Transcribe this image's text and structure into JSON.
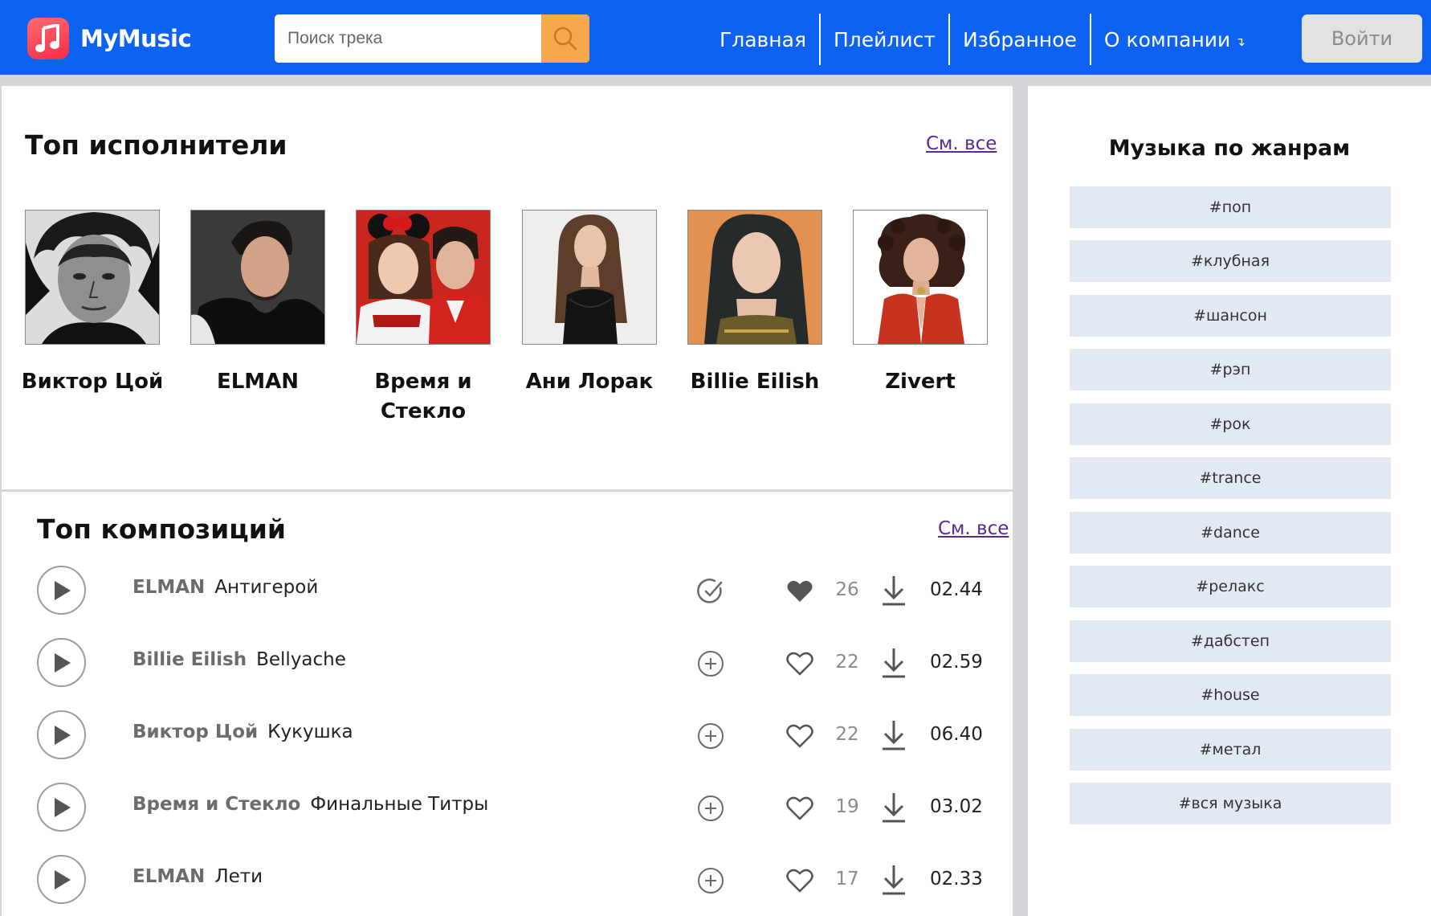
{
  "header": {
    "brand": "MyMusic",
    "search_placeholder": "Поиск трека",
    "nav": [
      "Главная",
      "Плейлист",
      "Избранное",
      "О компании"
    ],
    "nav_dropdown_arrow": "↴",
    "login_label": "Войти"
  },
  "top_artists": {
    "title": "Топ исполнители",
    "see_all": "См. все",
    "items": [
      {
        "name": "Виктор Цой",
        "photo": "bw-portrait-curly-hair"
      },
      {
        "name": "ELMAN",
        "photo": "portrait-dark-jacket"
      },
      {
        "name": "Время и Стекло",
        "photo": "duo-red-background"
      },
      {
        "name": "Ани Лорак",
        "photo": "portrait-long-hair-black-dress"
      },
      {
        "name": "Billie Eilish",
        "photo": "portrait-orange-background"
      },
      {
        "name": "Zivert",
        "photo": "portrait-curly-hair-red-jacket"
      }
    ]
  },
  "top_tracks": {
    "title": "Топ композиций",
    "see_all": "См. все",
    "items": [
      {
        "artist": "ELMAN",
        "title": "Антигерой",
        "added": true,
        "liked": true,
        "likes": "26",
        "duration": "02.44"
      },
      {
        "artist": "Billie Eilish",
        "title": "Bellyache",
        "added": false,
        "liked": false,
        "likes": "22",
        "duration": "02.59"
      },
      {
        "artist": "Виктор Цой",
        "title": "Кукушка",
        "added": false,
        "liked": false,
        "likes": "22",
        "duration": "06.40"
      },
      {
        "artist": "Время и Стекло",
        "title": "Финальные Титры",
        "added": false,
        "liked": false,
        "likes": "19",
        "duration": "03.02"
      },
      {
        "artist": "ELMAN",
        "title": "Лети",
        "added": false,
        "liked": false,
        "likes": "17",
        "duration": "02.33"
      }
    ]
  },
  "genres": {
    "title": "Музыка по жанрам",
    "items": [
      "#поп",
      "#клубная",
      "#шансон",
      "#рэп",
      "#рок",
      "#trance",
      "#dance",
      "#релакс",
      "#дабстеп",
      "#house",
      "#метал",
      "#вся музыка"
    ]
  },
  "colors": {
    "header_bg": "#0d62f2",
    "search_button": "#f8a84c",
    "link": "#5a2a8f",
    "genre_bg": "#e3e9f2",
    "page_bg": "#d6d6da"
  },
  "icons": {
    "brand": "music-note-icon",
    "search": "search-icon",
    "play": "play-icon",
    "added": "check-circle-icon",
    "add": "plus-circle-icon",
    "liked": "heart-filled-icon",
    "like": "heart-outline-icon",
    "download": "download-icon"
  }
}
